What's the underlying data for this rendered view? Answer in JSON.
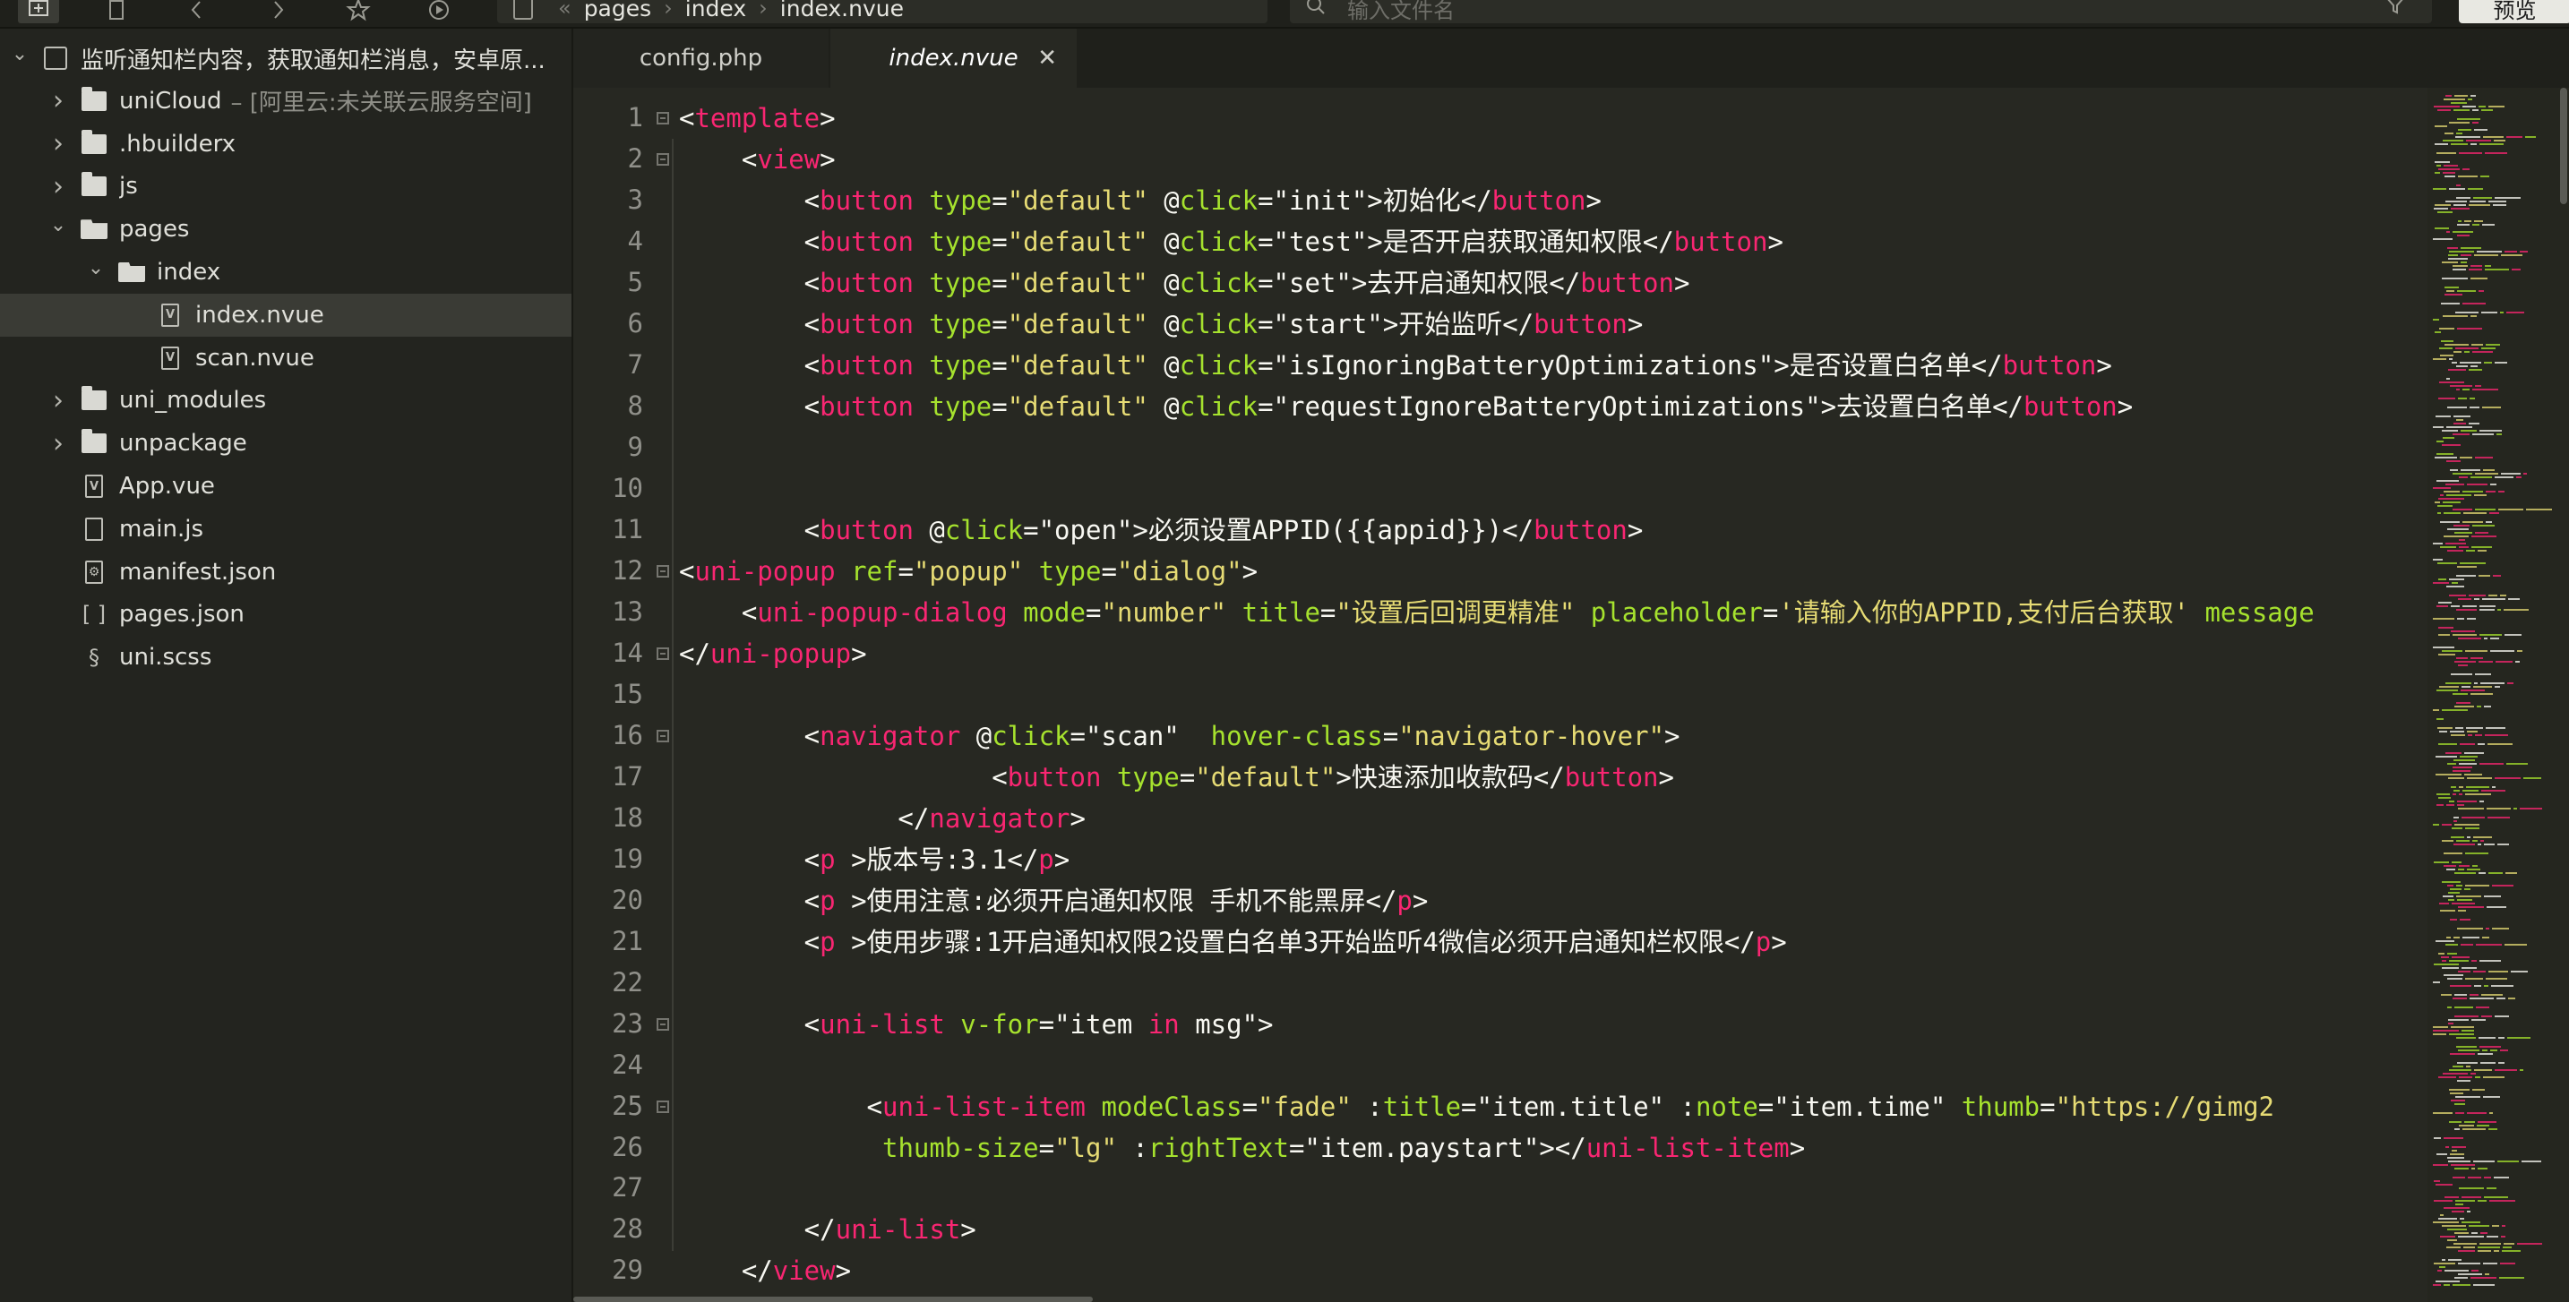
{
  "toolbar": {
    "buttons": [
      "new-window-icon",
      "file-icon",
      "back-icon",
      "forward-icon",
      "star-icon",
      "run-icon"
    ],
    "breadcrumb": [
      "pages",
      "index",
      "index.nvue"
    ],
    "search_placeholder": "输入文件名",
    "preview_label": "预览"
  },
  "sidebar": {
    "items": [
      {
        "label": "监听通知栏内容，获取通知栏消息，安卓原...",
        "sub": "",
        "icon": "project-icon",
        "depth": 0,
        "chevron": "down"
      },
      {
        "label": "uniCloud",
        "sub": "– [阿里云:未关联云服务空间]",
        "icon": "folder-icon",
        "depth": 1,
        "chevron": "right"
      },
      {
        "label": ".hbuilderx",
        "sub": "",
        "icon": "folder-icon",
        "depth": 1,
        "chevron": "right"
      },
      {
        "label": "js",
        "sub": "",
        "icon": "folder-icon",
        "depth": 1,
        "chevron": "right"
      },
      {
        "label": "pages",
        "sub": "",
        "icon": "folder-open-icon",
        "depth": 1,
        "chevron": "down"
      },
      {
        "label": "index",
        "sub": "",
        "icon": "folder-open-icon",
        "depth": 2,
        "chevron": "down"
      },
      {
        "label": "index.nvue",
        "sub": "",
        "icon": "vue-file-icon",
        "depth": 3,
        "chevron": "",
        "selected": true
      },
      {
        "label": "scan.nvue",
        "sub": "",
        "icon": "vue-file-icon",
        "depth": 3,
        "chevron": ""
      },
      {
        "label": "uni_modules",
        "sub": "",
        "icon": "folder-icon",
        "depth": 1,
        "chevron": "right"
      },
      {
        "label": "unpackage",
        "sub": "",
        "icon": "folder-icon",
        "depth": 1,
        "chevron": "right"
      },
      {
        "label": "App.vue",
        "sub": "",
        "icon": "vue-file-icon",
        "depth": 1,
        "chevron": ""
      },
      {
        "label": "main.js",
        "sub": "",
        "icon": "js-file-icon",
        "depth": 1,
        "chevron": ""
      },
      {
        "label": "manifest.json",
        "sub": "",
        "icon": "manifest-file-icon",
        "depth": 1,
        "chevron": ""
      },
      {
        "label": "pages.json",
        "sub": "",
        "icon": "json-file-icon",
        "depth": 1,
        "chevron": ""
      },
      {
        "label": "uni.scss",
        "sub": "",
        "icon": "scss-file-icon",
        "depth": 1,
        "chevron": ""
      }
    ]
  },
  "tabs": [
    {
      "label": "config.php",
      "active": false
    },
    {
      "label": "index.nvue",
      "active": true
    }
  ],
  "editor": {
    "lines": [
      {
        "n": "1",
        "fold": true,
        "tokens": [
          [
            "t",
            "<"
          ],
          [
            "g",
            "template"
          ],
          [
            "t",
            ">"
          ]
        ]
      },
      {
        "n": "2",
        "fold": true,
        "tokens": [
          [
            "t",
            "    <"
          ],
          [
            "g",
            "view"
          ],
          [
            "t",
            ">"
          ]
        ]
      },
      {
        "n": "3",
        "tokens": [
          [
            "t",
            "        <"
          ],
          [
            "g",
            "button"
          ],
          [
            "t",
            " "
          ],
          [
            "a",
            "type"
          ],
          [
            "t",
            "="
          ],
          [
            "s",
            "\"default\""
          ],
          [
            "t",
            " @"
          ],
          [
            "a",
            "click"
          ],
          [
            "t",
            "=\"init\">初始化</"
          ],
          [
            "g",
            "button"
          ],
          [
            "t",
            ">"
          ]
        ]
      },
      {
        "n": "4",
        "tokens": [
          [
            "t",
            "        <"
          ],
          [
            "g",
            "button"
          ],
          [
            "t",
            " "
          ],
          [
            "a",
            "type"
          ],
          [
            "t",
            "="
          ],
          [
            "s",
            "\"default\""
          ],
          [
            "t",
            " @"
          ],
          [
            "a",
            "click"
          ],
          [
            "t",
            "=\"test\">是否开启获取通知权限</"
          ],
          [
            "g",
            "button"
          ],
          [
            "t",
            ">"
          ]
        ]
      },
      {
        "n": "5",
        "tokens": [
          [
            "t",
            "        <"
          ],
          [
            "g",
            "button"
          ],
          [
            "t",
            " "
          ],
          [
            "a",
            "type"
          ],
          [
            "t",
            "="
          ],
          [
            "s",
            "\"default\""
          ],
          [
            "t",
            " @"
          ],
          [
            "a",
            "click"
          ],
          [
            "t",
            "=\"set\">去开启通知权限</"
          ],
          [
            "g",
            "button"
          ],
          [
            "t",
            ">"
          ]
        ]
      },
      {
        "n": "6",
        "tokens": [
          [
            "t",
            "        <"
          ],
          [
            "g",
            "button"
          ],
          [
            "t",
            " "
          ],
          [
            "a",
            "type"
          ],
          [
            "t",
            "="
          ],
          [
            "s",
            "\"default\""
          ],
          [
            "t",
            " @"
          ],
          [
            "a",
            "click"
          ],
          [
            "t",
            "=\"start\">开始监听</"
          ],
          [
            "g",
            "button"
          ],
          [
            "t",
            ">"
          ]
        ]
      },
      {
        "n": "7",
        "tokens": [
          [
            "t",
            "        <"
          ],
          [
            "g",
            "button"
          ],
          [
            "t",
            " "
          ],
          [
            "a",
            "type"
          ],
          [
            "t",
            "="
          ],
          [
            "s",
            "\"default\""
          ],
          [
            "t",
            " @"
          ],
          [
            "a",
            "click"
          ],
          [
            "t",
            "=\"isIgnoringBatteryOptimizations\">是否设置白名单</"
          ],
          [
            "g",
            "button"
          ],
          [
            "t",
            ">"
          ]
        ]
      },
      {
        "n": "8",
        "tokens": [
          [
            "t",
            "        <"
          ],
          [
            "g",
            "button"
          ],
          [
            "t",
            " "
          ],
          [
            "a",
            "type"
          ],
          [
            "t",
            "="
          ],
          [
            "s",
            "\"default\""
          ],
          [
            "t",
            " @"
          ],
          [
            "a",
            "click"
          ],
          [
            "t",
            "=\"requestIgnoreBatteryOptimizations\">去设置白名单</"
          ],
          [
            "g",
            "button"
          ],
          [
            "t",
            ">"
          ]
        ]
      },
      {
        "n": "9",
        "tokens": []
      },
      {
        "n": "10",
        "tokens": []
      },
      {
        "n": "11",
        "tokens": [
          [
            "t",
            "        <"
          ],
          [
            "g",
            "button"
          ],
          [
            "t",
            " @"
          ],
          [
            "a",
            "click"
          ],
          [
            "t",
            "=\"open\">必须设置APPID({{appid}})</"
          ],
          [
            "g",
            "button"
          ],
          [
            "t",
            ">"
          ]
        ]
      },
      {
        "n": "12",
        "fold": true,
        "tokens": [
          [
            "t",
            "<"
          ],
          [
            "g",
            "uni-popup"
          ],
          [
            "t",
            " "
          ],
          [
            "a",
            "ref"
          ],
          [
            "t",
            "="
          ],
          [
            "s",
            "\"popup\""
          ],
          [
            "t",
            " "
          ],
          [
            "a",
            "type"
          ],
          [
            "t",
            "="
          ],
          [
            "s",
            "\"dialog\""
          ],
          [
            "t",
            ">"
          ]
        ]
      },
      {
        "n": "13",
        "tokens": [
          [
            "t",
            "    <"
          ],
          [
            "g",
            "uni-popup-dialog"
          ],
          [
            "t",
            " "
          ],
          [
            "a",
            "mode"
          ],
          [
            "t",
            "="
          ],
          [
            "s",
            "\"number\""
          ],
          [
            "t",
            " "
          ],
          [
            "a",
            "title"
          ],
          [
            "t",
            "="
          ],
          [
            "s",
            "\"设置后回调更精准\""
          ],
          [
            "t",
            " "
          ],
          [
            "a",
            "placeholder"
          ],
          [
            "t",
            "="
          ],
          [
            "s",
            "'请输入你的APPID,支付后台获取'"
          ],
          [
            "t",
            " "
          ],
          [
            "a",
            "message"
          ]
        ]
      },
      {
        "n": "14",
        "fold": true,
        "tokens": [
          [
            "t",
            "</"
          ],
          [
            "g",
            "uni-popup"
          ],
          [
            "t",
            ">"
          ]
        ]
      },
      {
        "n": "15",
        "tokens": []
      },
      {
        "n": "16",
        "fold": true,
        "tokens": [
          [
            "t",
            "        <"
          ],
          [
            "g",
            "navigator"
          ],
          [
            "t",
            " @"
          ],
          [
            "a",
            "click"
          ],
          [
            "t",
            "=\"scan\"  "
          ],
          [
            "a",
            "hover-class"
          ],
          [
            "t",
            "="
          ],
          [
            "s",
            "\"navigator-hover\""
          ],
          [
            "t",
            ">"
          ]
        ]
      },
      {
        "n": "17",
        "tokens": [
          [
            "t",
            "                    <"
          ],
          [
            "g",
            "button"
          ],
          [
            "t",
            " "
          ],
          [
            "a",
            "type"
          ],
          [
            "t",
            "="
          ],
          [
            "s",
            "\"default\""
          ],
          [
            "t",
            ">快速添加收款码</"
          ],
          [
            "g",
            "button"
          ],
          [
            "t",
            ">"
          ]
        ]
      },
      {
        "n": "18",
        "tokens": [
          [
            "t",
            "              </"
          ],
          [
            "g",
            "navigator"
          ],
          [
            "t",
            ">"
          ]
        ]
      },
      {
        "n": "19",
        "tokens": [
          [
            "t",
            "        <"
          ],
          [
            "g",
            "p"
          ],
          [
            "t",
            " >版本号:3.1</"
          ],
          [
            "g",
            "p"
          ],
          [
            "t",
            ">"
          ]
        ]
      },
      {
        "n": "20",
        "tokens": [
          [
            "t",
            "        <"
          ],
          [
            "g",
            "p"
          ],
          [
            "t",
            " >使用注意:必须开启通知权限 手机不能黑屏</"
          ],
          [
            "g",
            "p"
          ],
          [
            "t",
            ">"
          ]
        ]
      },
      {
        "n": "21",
        "tokens": [
          [
            "t",
            "        <"
          ],
          [
            "g",
            "p"
          ],
          [
            "t",
            " >使用步骤:1开启通知权限2设置白名单3开始监听4微信必须开启通知栏权限</"
          ],
          [
            "g",
            "p"
          ],
          [
            "t",
            ">"
          ]
        ]
      },
      {
        "n": "22",
        "tokens": []
      },
      {
        "n": "23",
        "fold": true,
        "tokens": [
          [
            "t",
            "        <"
          ],
          [
            "g",
            "uni-list"
          ],
          [
            "t",
            " "
          ],
          [
            "a",
            "v-for"
          ],
          [
            "t",
            "=\"item "
          ],
          [
            "g",
            "in"
          ],
          [
            "t",
            " msg\">"
          ]
        ]
      },
      {
        "n": "24",
        "tokens": []
      },
      {
        "n": "25",
        "fold": true,
        "tokens": [
          [
            "t",
            "            <"
          ],
          [
            "g",
            "uni-list-item"
          ],
          [
            "t",
            " "
          ],
          [
            "a",
            "modeClass"
          ],
          [
            "t",
            "="
          ],
          [
            "s",
            "\"fade\""
          ],
          [
            "t",
            " :"
          ],
          [
            "a",
            "title"
          ],
          [
            "t",
            "=\"item.title\" :"
          ],
          [
            "a",
            "note"
          ],
          [
            "t",
            "=\"item.time\" "
          ],
          [
            "a",
            "thumb"
          ],
          [
            "t",
            "="
          ],
          [
            "s",
            "\"https://gimg2"
          ]
        ]
      },
      {
        "n": "26",
        "tokens": [
          [
            "t",
            "             "
          ],
          [
            "a",
            "thumb-size"
          ],
          [
            "t",
            "="
          ],
          [
            "s",
            "\"lg\""
          ],
          [
            "t",
            " :"
          ],
          [
            "a",
            "rightText"
          ],
          [
            "t",
            "=\"item.paystart\"></"
          ],
          [
            "g",
            "uni-list-item"
          ],
          [
            "t",
            ">"
          ]
        ]
      },
      {
        "n": "27",
        "tokens": []
      },
      {
        "n": "28",
        "tokens": [
          [
            "t",
            "        </"
          ],
          [
            "g",
            "uni-list"
          ],
          [
            "t",
            ">"
          ]
        ]
      },
      {
        "n": "29",
        "tokens": [
          [
            "t",
            "    </"
          ],
          [
            "g",
            "view"
          ],
          [
            "t",
            ">"
          ]
        ]
      }
    ]
  }
}
